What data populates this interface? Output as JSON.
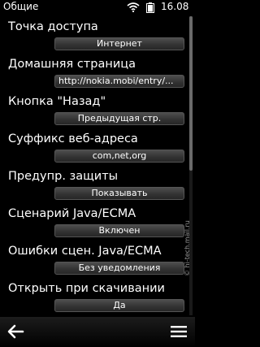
{
  "status": {
    "title": "Общие",
    "time": "16.08"
  },
  "settings": [
    {
      "label": "Точка доступа",
      "value": "Интернет"
    },
    {
      "label": "Домашняя страница",
      "value": "http://nokia.mobi/entry/..."
    },
    {
      "label": "Кнопка \"Назад\"",
      "value": "Предыдущая стр."
    },
    {
      "label": "Суффикс веб-адреса",
      "value": "com,net,org"
    },
    {
      "label": "Предупр. защиты",
      "value": "Показывать"
    },
    {
      "label": "Сценарий Java/ECMA",
      "value": "Включен"
    },
    {
      "label": "Ошибки сцен. Java/ECMA",
      "value": "Без уведомления"
    },
    {
      "label": "Открыть при скачивании",
      "value": "Да"
    }
  ],
  "toolbar": {
    "back_icon": "back-arrow-icon",
    "menu_icon": "menu-icon"
  },
  "watermark": "© hi-tech.mail.ru"
}
